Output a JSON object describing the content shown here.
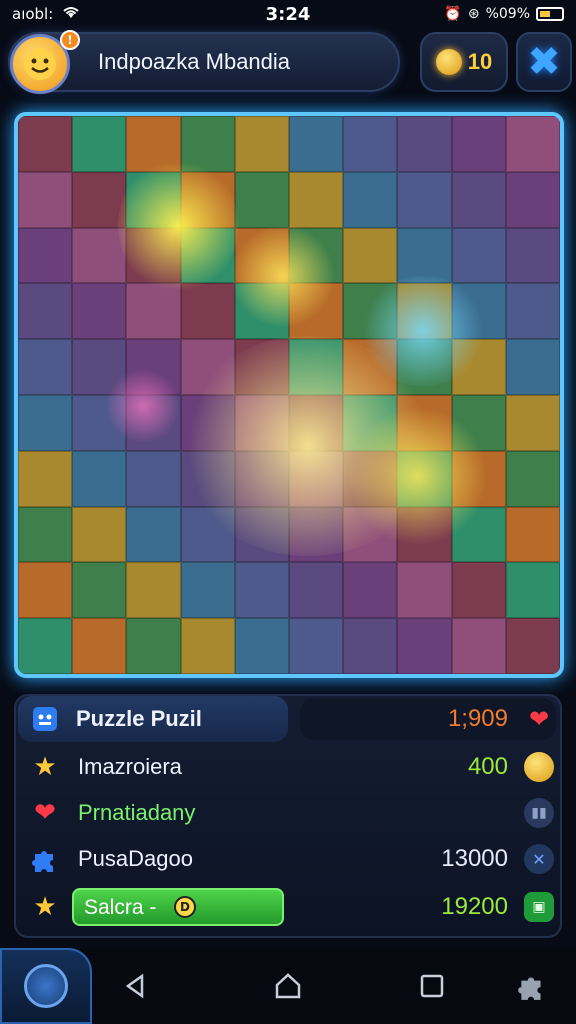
{
  "status_bar": {
    "carrier": "aıobl:",
    "time": "3:24",
    "battery": "%09%"
  },
  "header": {
    "avatar_badge": "!",
    "title": "Indpoazka Mbandia",
    "coins": "10",
    "close_glyph": "✖"
  },
  "puzzle": {
    "columns": 10,
    "rows": 10,
    "colors": [
      "#7d3b4f",
      "#3e7f4b",
      "#4f5a8c",
      "#8f4f7a",
      "#b76a2a",
      "#3a6d8f",
      "#6a3f7a",
      "#2f8f6b",
      "#a9892f",
      "#5a4a7f"
    ]
  },
  "stats": [
    {
      "name": "puzzle-header-row",
      "icon": "puzzle-icon",
      "label": "Puzzle Puzil",
      "value": "1;909",
      "value_color": "#f27b2c",
      "ricon": "heart-icon"
    },
    {
      "name": "stat-row-1",
      "icon": "star-icon",
      "label": "Imazroiera",
      "value": "400",
      "value_color": "#9bea3b",
      "ricon": "coin-icon"
    },
    {
      "name": "stat-row-2",
      "icon": "heart-icon",
      "label": "Prnatiadany",
      "value": "",
      "value_color": "#9bea3b",
      "ricon": "pause-icon"
    },
    {
      "name": "stat-row-3",
      "icon": "puzzle-piece-icon",
      "label": "PusaDagoo",
      "value": "13000",
      "value_color": "#e6ebf7",
      "ricon": "close-icon"
    },
    {
      "name": "stat-row-4",
      "icon": "star-icon",
      "label": "Salcra -",
      "value": "19200",
      "value_color": "#9bea3b",
      "ricon": "window-icon"
    }
  ],
  "action_button": {
    "label": "Salcra -",
    "badge": "D"
  }
}
